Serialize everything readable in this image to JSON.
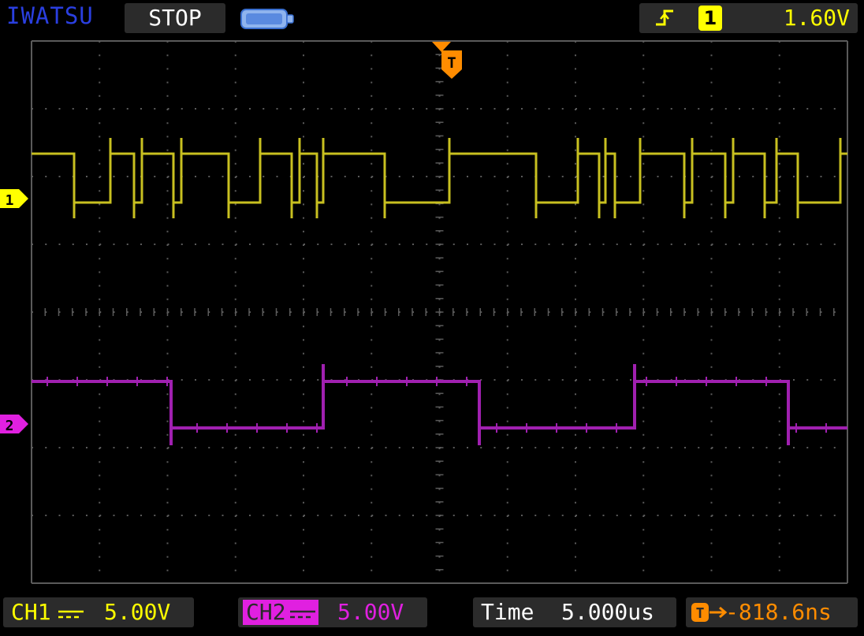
{
  "brand": "IWATSU",
  "run_state": "STOP",
  "trigger": {
    "edge_icon": "rising-edge-icon",
    "source": "1",
    "level": "1.60V"
  },
  "markers": {
    "trigger_position": "T",
    "ch1": "1",
    "ch2": "2"
  },
  "channels": [
    {
      "label": "CH1",
      "coupling_icon": "dc-coupling-icon",
      "scale": "5.00V",
      "color": "#ffff00"
    },
    {
      "label": "CH2",
      "coupling_icon": "dc-coupling-icon",
      "scale": "5.00V",
      "color": "#e020e0"
    }
  ],
  "timebase": {
    "label": "Time",
    "value": "5.000us"
  },
  "trigger_offset": {
    "icon": "trigger-offset-icon",
    "value": "-818.6ns",
    "color": "#ff8c00"
  },
  "colors": {
    "ch1_trace": "#c8c020",
    "ch2_trace": "#a020b0",
    "grid": "#5a5a5a",
    "trigger_marker": "#ff8c00",
    "brand": "#2a3fe0"
  }
}
